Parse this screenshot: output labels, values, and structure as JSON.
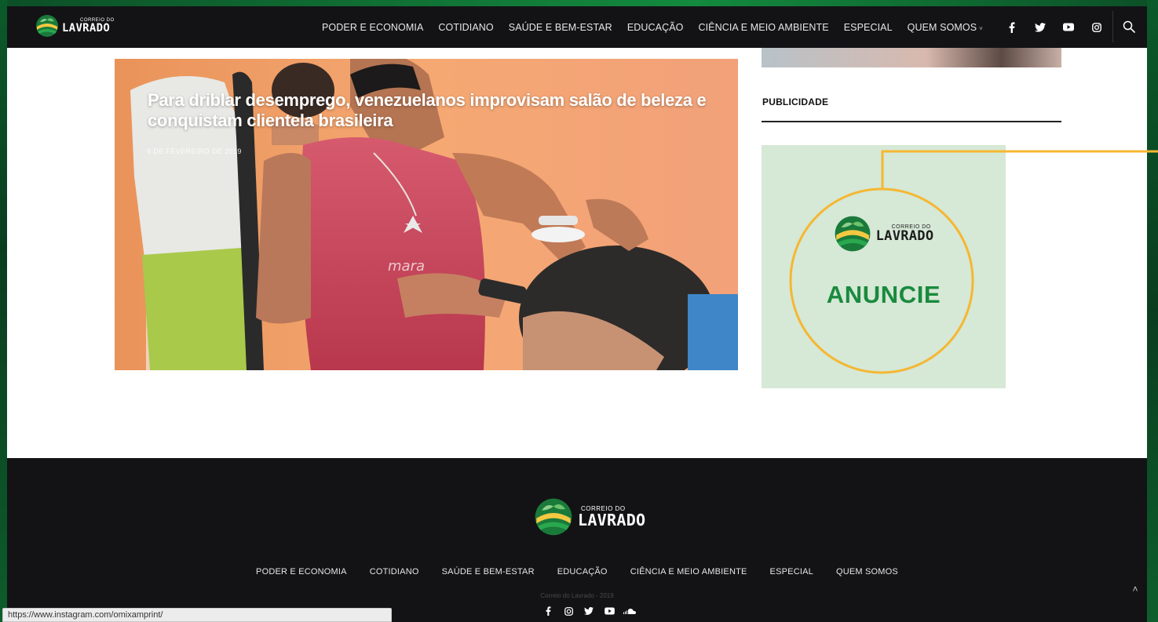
{
  "brand": {
    "small": "CORREIO DO",
    "big": "LAVRADO"
  },
  "nav": {
    "items": [
      "PODER E ECONOMIA",
      "COTIDIANO",
      "SAÚDE E BEM-ESTAR",
      "EDUCAÇÃO",
      "CIÊNCIA E MEIO AMBIENTE",
      "ESPECIAL",
      "QUEM SOMOS"
    ],
    "dropdown_caret": "˅",
    "social_icons": [
      "facebook-icon",
      "twitter-icon",
      "youtube-icon",
      "instagram-icon"
    ],
    "search_icon": "search-icon"
  },
  "hero": {
    "title": "Para driblar desemprego, venezuelanos improvisam salão de beleza e conquistam clientela brasileira",
    "date": "9 DE FEVEREIRO DE 2019"
  },
  "sidebar": {
    "section_title": "PUBLICIDADE",
    "ad": {
      "brand_small": "CORREIO DO",
      "brand_big": "LAVRADO",
      "cta": "ANUNCIE"
    }
  },
  "footer": {
    "brand_small": "CORREIO DO",
    "brand_big": "LAVRADO",
    "menu": [
      "PODER E ECONOMIA",
      "COTIDIANO",
      "SAÚDE E BEM-ESTAR",
      "EDUCAÇÃO",
      "CIÊNCIA E MEIO AMBIENTE",
      "ESPECIAL",
      "QUEM SOMOS"
    ],
    "copyright": "Correio do Lavrado - 2019",
    "social_icons": [
      "facebook-icon",
      "instagram-icon",
      "twitter-icon",
      "youtube-icon",
      "soundcloud-icon"
    ],
    "back_to_top": "˄"
  },
  "status_bar": {
    "url": "https://www.instagram.com/omixamprint/"
  },
  "colors": {
    "accent_green": "#1a8a3e",
    "callout_yellow": "#f5b731",
    "dark_bg": "#131316",
    "ad_bg": "#d6e8d6"
  }
}
